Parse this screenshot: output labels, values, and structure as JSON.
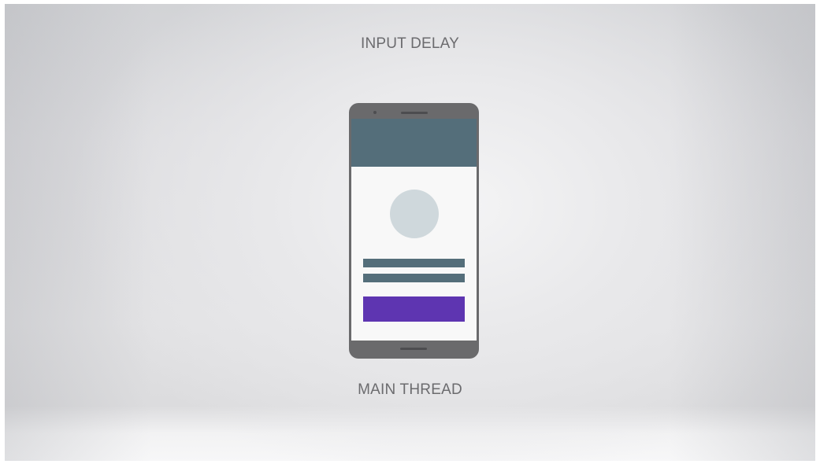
{
  "labels": {
    "top": "INPUT DELAY",
    "bottom": "MAIN THREAD"
  },
  "colors": {
    "phone_body": "#6a6a6c",
    "header": "#546e7a",
    "avatar": "#cfd8dc",
    "text_lines": "#546e7a",
    "action_button": "#5e35b1",
    "label_text": "#6b6b6e"
  }
}
